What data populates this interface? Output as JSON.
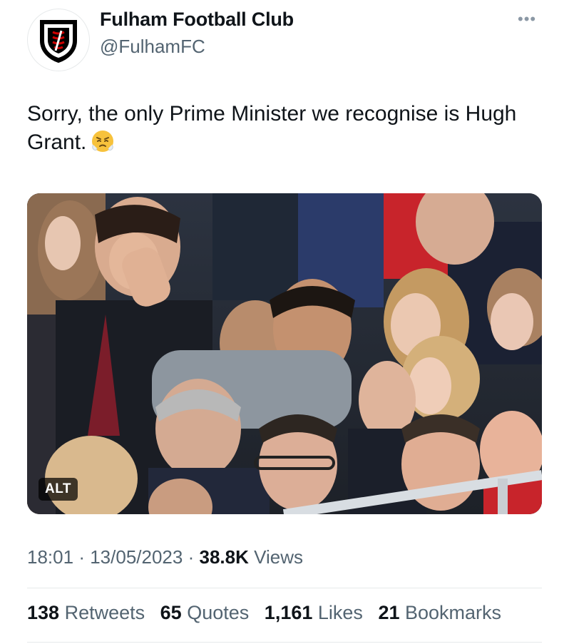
{
  "account": {
    "name": "Fulham Football Club",
    "handle": "@FulhamFC",
    "avatar_icon": "fulham-crest-icon"
  },
  "more_icon": "ellipsis-icon",
  "tweet": {
    "text": "Sorry, the only Prime Minister we recognise is Hugh Grant.",
    "emoji_icon": "steam-from-nose-face-emoji"
  },
  "media": {
    "alt_label": "ALT"
  },
  "meta": {
    "time": "18:01",
    "dot1": "·",
    "date": "13/05/2023",
    "dot2": "·",
    "views_count": "38.8K",
    "views_label": "Views"
  },
  "stats": [
    {
      "count": "138",
      "label": "Retweets"
    },
    {
      "count": "65",
      "label": "Quotes"
    },
    {
      "count": "1,161",
      "label": "Likes"
    },
    {
      "count": "21",
      "label": "Bookmarks"
    }
  ],
  "colors": {
    "text": "#0f1419",
    "secondary": "#536471",
    "divider": "#e6e9ea",
    "crest_red": "#cc0000"
  }
}
